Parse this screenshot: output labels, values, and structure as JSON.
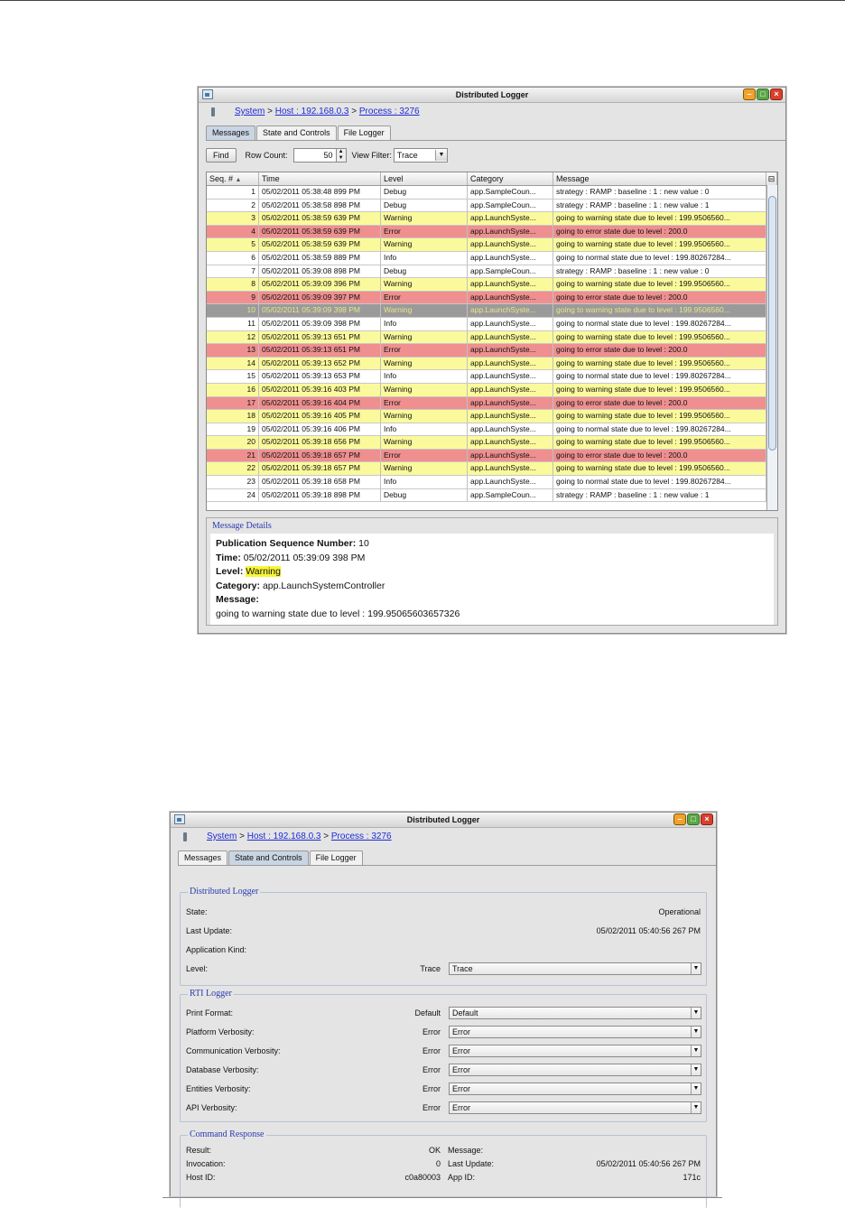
{
  "window_title": "Distributed Logger",
  "breadcrumb": {
    "system": "System",
    "host": "Host : 192.168.0.3",
    "process": "Process : 3276",
    "sep": ">"
  },
  "tabs": [
    "Messages",
    "State and Controls",
    "File Logger"
  ],
  "toolbar": {
    "find": "Find",
    "row_count_label": "Row Count:",
    "row_count": "50",
    "view_filter_label": "View Filter:",
    "view_filter": "Trace"
  },
  "grid": {
    "headers": [
      "Seq. #",
      "Time",
      "Level",
      "Category",
      "Message"
    ],
    "rows": [
      [
        "1",
        "05/02/2011 05:38:48 899 PM",
        "Debug",
        "app.SampleCoun...",
        "strategy : RAMP : baseline : 1 : new value : 0"
      ],
      [
        "2",
        "05/02/2011 05:38:58 898 PM",
        "Debug",
        "app.SampleCoun...",
        "strategy : RAMP : baseline : 1 : new value : 1"
      ],
      [
        "3",
        "05/02/2011 05:38:59 639 PM",
        "Warning",
        "app.LaunchSyste...",
        "going to warning state due to level : 199.9506560..."
      ],
      [
        "4",
        "05/02/2011 05:38:59 639 PM",
        "Error",
        "app.LaunchSyste...",
        "going to error state due to level : 200.0"
      ],
      [
        "5",
        "05/02/2011 05:38:59 639 PM",
        "Warning",
        "app.LaunchSyste...",
        "going to warning state due to level : 199.9506560..."
      ],
      [
        "6",
        "05/02/2011 05:38:59 889 PM",
        "Info",
        "app.LaunchSyste...",
        "going to normal state due to level : 199.80267284..."
      ],
      [
        "7",
        "05/02/2011 05:39:08 898 PM",
        "Debug",
        "app.SampleCoun...",
        "strategy : RAMP : baseline : 1 : new value : 0"
      ],
      [
        "8",
        "05/02/2011 05:39:09 396 PM",
        "Warning",
        "app.LaunchSyste...",
        "going to warning state due to level : 199.9506560..."
      ],
      [
        "9",
        "05/02/2011 05:39:09 397 PM",
        "Error",
        "app.LaunchSyste...",
        "going to error state due to level : 200.0"
      ],
      [
        "10",
        "05/02/2011 05:39:09 398 PM",
        "Warning",
        "app.LaunchSyste...",
        "going to warning state due to level : 199.9506560..."
      ],
      [
        "11",
        "05/02/2011 05:39:09 398 PM",
        "Info",
        "app.LaunchSyste...",
        "going to normal state due to level : 199.80267284..."
      ],
      [
        "12",
        "05/02/2011 05:39:13 651 PM",
        "Warning",
        "app.LaunchSyste...",
        "going to warning state due to level : 199.9506560..."
      ],
      [
        "13",
        "05/02/2011 05:39:13 651 PM",
        "Error",
        "app.LaunchSyste...",
        "going to error state due to level : 200.0"
      ],
      [
        "14",
        "05/02/2011 05:39:13 652 PM",
        "Warning",
        "app.LaunchSyste...",
        "going to warning state due to level : 199.9506560..."
      ],
      [
        "15",
        "05/02/2011 05:39:13 653 PM",
        "Info",
        "app.LaunchSyste...",
        "going to normal state due to level : 199.80267284..."
      ],
      [
        "16",
        "05/02/2011 05:39:16 403 PM",
        "Warning",
        "app.LaunchSyste...",
        "going to warning state due to level : 199.9506560..."
      ],
      [
        "17",
        "05/02/2011 05:39:16 404 PM",
        "Error",
        "app.LaunchSyste...",
        "going to error state due to level : 200.0"
      ],
      [
        "18",
        "05/02/2011 05:39:16 405 PM",
        "Warning",
        "app.LaunchSyste...",
        "going to warning state due to level : 199.9506560..."
      ],
      [
        "19",
        "05/02/2011 05:39:16 406 PM",
        "Info",
        "app.LaunchSyste...",
        "going to normal state due to level : 199.80267284..."
      ],
      [
        "20",
        "05/02/2011 05:39:18 656 PM",
        "Warning",
        "app.LaunchSyste...",
        "going to warning state due to level : 199.9506560..."
      ],
      [
        "21",
        "05/02/2011 05:39:18 657 PM",
        "Error",
        "app.LaunchSyste...",
        "going to error state due to level : 200.0"
      ],
      [
        "22",
        "05/02/2011 05:39:18 657 PM",
        "Warning",
        "app.LaunchSyste...",
        "going to warning state due to level : 199.9506560..."
      ],
      [
        "23",
        "05/02/2011 05:39:18 658 PM",
        "Info",
        "app.LaunchSyste...",
        "going to normal state due to level : 199.80267284..."
      ],
      [
        "24",
        "05/02/2011 05:39:18 898 PM",
        "Debug",
        "app.SampleCoun...",
        "strategy : RAMP : baseline : 1 : new value : 1"
      ]
    ],
    "selected_seq": "10"
  },
  "details": {
    "legend": "Message Details",
    "seq_label": "Publication Sequence Number:",
    "seq": "10",
    "time_label": "Time:",
    "time": "05/02/2011 05:39:09 398 PM",
    "level_label": "Level:",
    "level": "Warning",
    "category_label": "Category:",
    "category": "app.LaunchSystemController",
    "message_label": "Message:",
    "message": "going to warning state due to level : 199.95065603657326"
  },
  "state": {
    "dl_legend": "Distributed Logger",
    "state_label": "State:",
    "state_value": "Operational",
    "last_update_label": "Last Update:",
    "last_update_value": "05/02/2011 05:40:56 267 PM",
    "app_kind_label": "Application Kind:",
    "level_label": "Level:",
    "level_value": "Trace",
    "level_select": "Trace",
    "rti_legend": "RTI Logger",
    "rti_rows": [
      {
        "label": "Print Format:",
        "value": "Default",
        "select": "Default"
      },
      {
        "label": "Platform Verbosity:",
        "value": "Error",
        "select": "Error"
      },
      {
        "label": "Communication Verbosity:",
        "value": "Error",
        "select": "Error"
      },
      {
        "label": "Database Verbosity:",
        "value": "Error",
        "select": "Error"
      },
      {
        "label": "Entities Verbosity:",
        "value": "Error",
        "select": "Error"
      },
      {
        "label": "API Verbosity:",
        "value": "Error",
        "select": "Error"
      }
    ],
    "cmd_legend": "Command Response",
    "result_label": "Result:",
    "result_value": "OK",
    "message_label": "Message:",
    "invocation_label": "Invocation:",
    "invocation_value": "0",
    "cmd_last_update_label": "Last Update:",
    "cmd_last_update_value": "05/02/2011 05:40:56 267 PM",
    "host_id_label": "Host ID:",
    "host_id_value": "c0a80003",
    "app_id_label": "App ID:",
    "app_id_value": "171c"
  }
}
